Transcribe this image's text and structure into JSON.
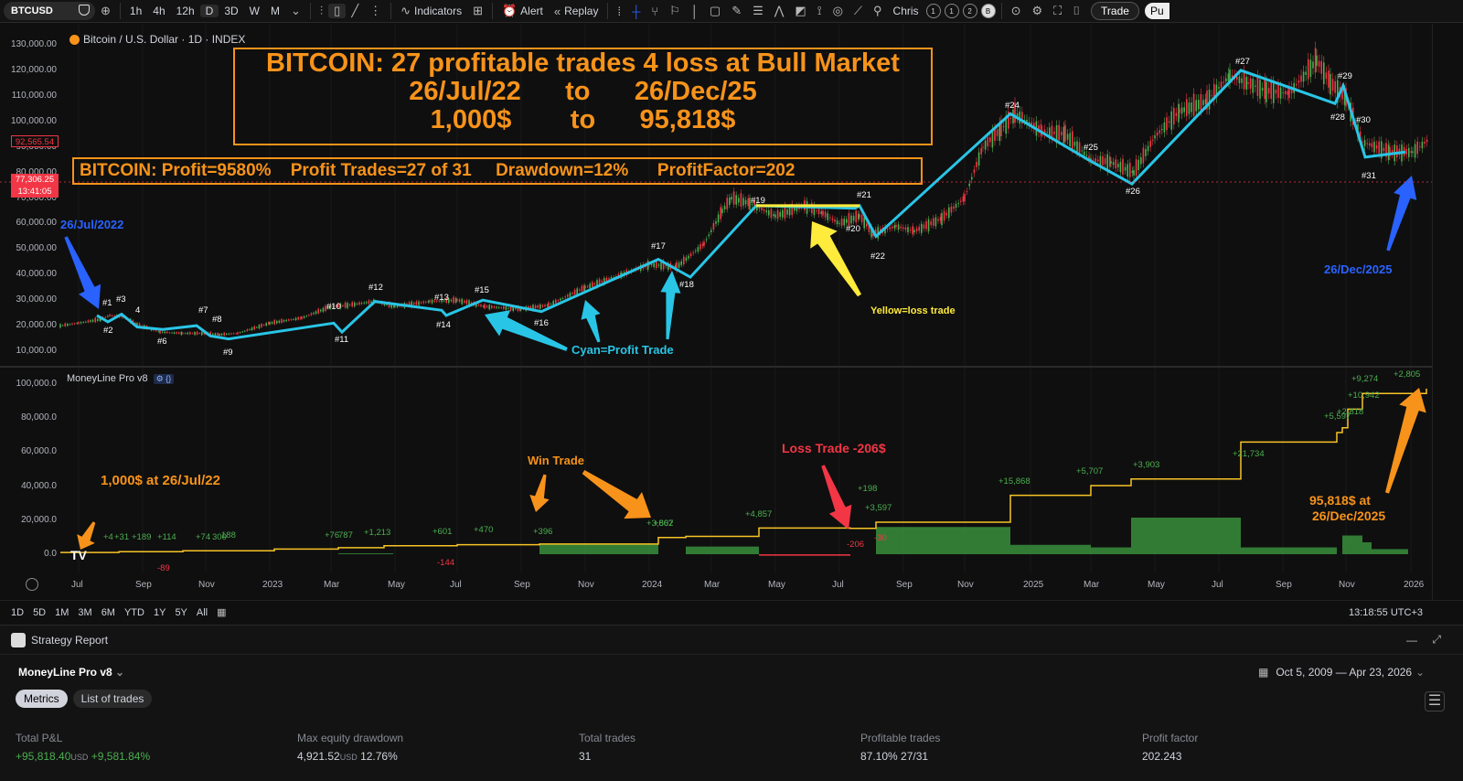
{
  "toolbar": {
    "symbol": "BTCUSD",
    "intervals": [
      "1h",
      "4h",
      "12h",
      "D",
      "3D",
      "W",
      "M"
    ],
    "active_interval": "D",
    "indicators_label": "Indicators",
    "alert_label": "Alert",
    "replay_label": "Replay",
    "user": "Chris",
    "layouts": [
      "1",
      "1",
      "2",
      "B"
    ],
    "trade_label": "Trade",
    "publish_label": "Pu"
  },
  "chart": {
    "title": "Bitcoin / U.S. Dollar · 1D · INDEX",
    "headline": "BITCOIN: 27 profitable trades 4 loss  at Bull Market",
    "headline_dates": "26/Jul/22      to      26/Dec/25",
    "headline_money": "1,000$        to      95,818$",
    "stats": "BITCOIN: Profit=9580%    Profit Trades=27 of 31     Drawdown=12%      ProfitFactor=202",
    "price_tag_1": "92,565.54",
    "price_tag_2a": "77,306.25",
    "price_tag_2b": "13:41:05",
    "y_ticks": [
      "130,000.00",
      "120,000.00",
      "110,000.00",
      "100,000.00",
      "90,000.00",
      "80,000.00",
      "70,000.00",
      "60,000.00",
      "50,000.00",
      "40,000.00",
      "30,000.00",
      "20,000.00",
      "10,000.00"
    ],
    "annotations": {
      "start_date": "26/Jul/2022",
      "end_date": "26/Dec/2025",
      "cyan_note": "Cyan=Profit Trade",
      "yellow_note": "Yellow=loss trade"
    },
    "trade_labels": [
      "#1",
      "#2",
      "#3",
      "4",
      "#6",
      "#7",
      "#8",
      "#9",
      "#10",
      "#11",
      "#12",
      "#13",
      "#14",
      "#15",
      "#16",
      "#17",
      "#18",
      "#19",
      "#20",
      "#21",
      "#22",
      "#24",
      "#25",
      "#26",
      "#27",
      "#28",
      "#29",
      "#30",
      "#31"
    ],
    "colors": {
      "profit_line": "#29c5e6",
      "loss_line": "#ffeb3b",
      "accent": "#f7931a",
      "bull_candle": "#4caf50",
      "bear_candle": "#f23645",
      "annotation_blue": "#2962ff"
    }
  },
  "indicator": {
    "title": "MoneyLine Pro v8",
    "y_ticks": [
      "100,000.0",
      "80,000.0",
      "60,000.0",
      "40,000.0",
      "20,000.0",
      "0.0"
    ],
    "start_note": "1,000$ at 26/Jul/22",
    "win_note": "Win Trade",
    "loss_note": "Loss Trade -206$",
    "end_note_1": "95,818$ at",
    "end_note_2": "26/Dec/2025",
    "trade_pnls": {
      "green": [
        "+4",
        "+31",
        "+189",
        "+114",
        "+74",
        "300",
        "188",
        "+76",
        "787",
        "+1,213",
        "+601",
        "+470",
        "+396",
        "+3,807",
        "+662",
        "+4,857",
        "+198",
        "+3,597",
        "+15,868",
        "+5,707",
        "+3,903",
        "+21,734",
        "+5,597",
        "+2,818",
        "+10,942",
        "+9,274",
        "+2,805"
      ],
      "red": [
        "-89",
        "-144",
        "-206",
        "-30"
      ]
    },
    "equity_final": 95818.4
  },
  "x_axis": [
    "Jul",
    "Sep",
    "Nov",
    "2023",
    "Mar",
    "May",
    "Jul",
    "Sep",
    "Nov",
    "2024",
    "Mar",
    "May",
    "Jul",
    "Sep",
    "Nov",
    "2025",
    "Mar",
    "May",
    "Jul",
    "Sep",
    "Nov",
    "2026"
  ],
  "range_bar": {
    "ranges": [
      "1D",
      "5D",
      "1M",
      "3M",
      "6M",
      "YTD",
      "1Y",
      "5Y",
      "All"
    ],
    "clock": "13:18:55 UTC+3"
  },
  "report": {
    "panel_title": "Strategy Report",
    "strategy_name": "MoneyLine Pro v8",
    "date_range": "Oct 5, 2009 — Apr 23, 2026",
    "tabs": [
      "Metrics",
      "List of trades"
    ],
    "metrics": [
      {
        "label": "Total P&L",
        "value": "+95,818.40",
        "unit": "USD",
        "extra": "+9,581.84%"
      },
      {
        "label": "Max equity drawdown",
        "value": "4,921.52",
        "unit": "USD",
        "extra": "12.76%"
      },
      {
        "label": "Total trades",
        "value": "31",
        "unit": "",
        "extra": ""
      },
      {
        "label": "Profitable trades",
        "value": "87.10%",
        "unit": "",
        "extra": "27/31"
      },
      {
        "label": "Profit factor",
        "value": "202.243",
        "unit": "",
        "extra": ""
      }
    ]
  }
}
